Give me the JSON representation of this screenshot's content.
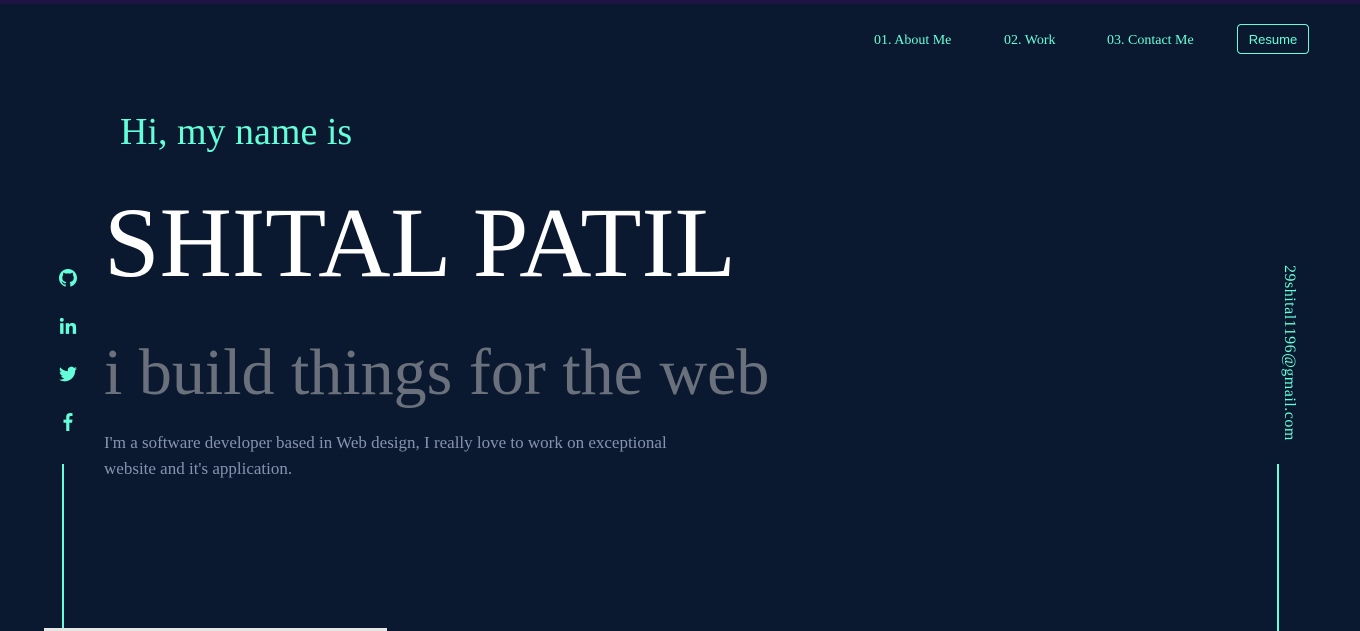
{
  "nav": {
    "links": [
      "01. About Me",
      "02. Work",
      "03. Contact Me"
    ],
    "resume_label": "Resume"
  },
  "hero": {
    "greeting": "Hi, my name is",
    "name": "SHITAL PATIL",
    "tagline": "i build things for the web",
    "bio": "I'm a software developer based in Web design, I really love to work on exceptional website and it's application."
  },
  "social": {
    "icons": [
      "github-icon",
      "linkedin-icon",
      "twitter-icon",
      "facebook-icon"
    ]
  },
  "email": "29shital1196@gmail.com",
  "colors": {
    "background": "#0a192f",
    "accent": "#64ffda",
    "heading": "#ffffff",
    "muted": "#6b717c",
    "body_text": "#8892b0"
  }
}
